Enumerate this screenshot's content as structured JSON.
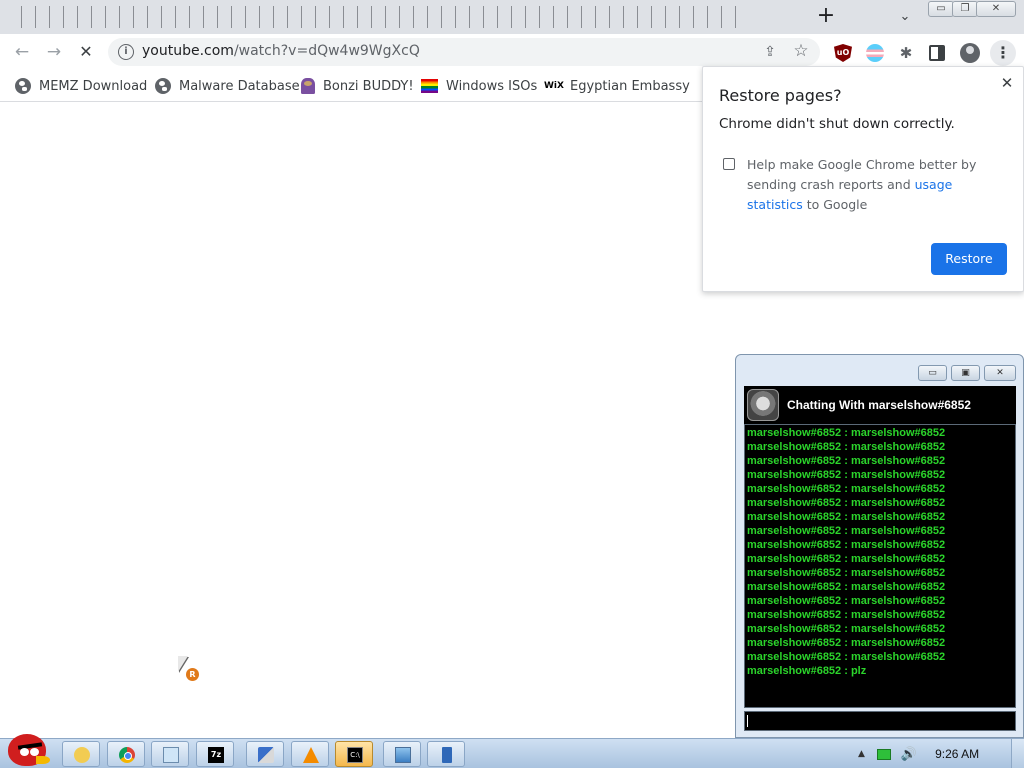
{
  "browser": {
    "tab_count": 52,
    "new_tab_glyph": "+",
    "tab_search_glyph": "⌄",
    "window_controls": {
      "minimize": "▭",
      "maximize": "❐",
      "close": "✕"
    },
    "nav": {
      "back": "←",
      "forward": "→",
      "stop": "✕"
    },
    "url_host": "youtube.com",
    "url_path": "/watch?v=dQw4w9WgXcQ",
    "icons": [
      "lock-icon",
      "share-icon",
      "star-icon",
      "ublock-icon",
      "trans-flag-extension-icon",
      "puzzle-icon",
      "side-panel-icon",
      "profile-icon",
      "menu-icon"
    ],
    "extensions": {
      "ublock_label": "uO",
      "menu_glyph": "⋮",
      "puzzle_glyph": "✱"
    }
  },
  "bookmarks": [
    {
      "label": "MEMZ Download",
      "icon": "globe-icon"
    },
    {
      "label": "Malware Database",
      "icon": "globe-icon"
    },
    {
      "label": "Bonzi BUDDY!",
      "icon": "bonzi-icon"
    },
    {
      "label": "Windows ISOs",
      "icon": "rainbow-flag-icon"
    },
    {
      "label": "Egyptian Embassy",
      "icon": "wix-icon",
      "icon_text": "WiX"
    }
  ],
  "restore_dialog": {
    "title": "Restore pages?",
    "message": "Chrome didn't shut down correctly.",
    "checkbox_text_before": "Help make Google Chrome better by sending crash reports and ",
    "checkbox_link": "usage statistics",
    "checkbox_text_after": " to Google",
    "checkbox_checked": false,
    "close_glyph": "✕",
    "button": "Restore",
    "button_color": "#1a73e8"
  },
  "chat": {
    "title": "Chatting With marselshow#6852",
    "controls": {
      "minimize": "▭",
      "maximize": "▣",
      "close": "✕"
    },
    "text_color": "#2bd42b",
    "messages": [
      "marselshow#6852 : marselshow#6852",
      "marselshow#6852 : marselshow#6852",
      "marselshow#6852 : marselshow#6852",
      "marselshow#6852 : marselshow#6852",
      "marselshow#6852 : marselshow#6852",
      "marselshow#6852 : marselshow#6852",
      "marselshow#6852 : marselshow#6852",
      "marselshow#6852 : marselshow#6852",
      "marselshow#6852 : marselshow#6852",
      "marselshow#6852 : marselshow#6852",
      "marselshow#6852 : marselshow#6852",
      "marselshow#6852 : marselshow#6852",
      "marselshow#6852 : marselshow#6852",
      "marselshow#6852 : marselshow#6852",
      "marselshow#6852 : marselshow#6852",
      "marselshow#6852 : marselshow#6852",
      "marselshow#6852 : marselshow#6852",
      "marselshow#6852 : plz"
    ],
    "input_value": ""
  },
  "cursor": {
    "icon": "cursor-arrow-icon",
    "badge": "R"
  },
  "taskbar": {
    "start_icon": "angry-bird-icon",
    "apps": [
      {
        "name": "explorer",
        "icon": "folder-icon",
        "active": false
      },
      {
        "name": "chrome",
        "icon": "chrome-icon",
        "active": false
      },
      {
        "name": "notepad",
        "icon": "notepad-icon",
        "active": false
      },
      {
        "name": "7zip",
        "icon": "7zip-icon",
        "active": false,
        "text": "7z"
      },
      {
        "name": "control",
        "icon": "control-panel-icon",
        "active": false
      },
      {
        "name": "vlc",
        "icon": "vlc-icon",
        "active": false
      },
      {
        "name": "cmd",
        "icon": "cmd-icon",
        "active": true,
        "text": "C:\\"
      },
      {
        "name": "photos",
        "icon": "photo-viewer-icon",
        "active": false
      },
      {
        "name": "doc",
        "icon": "document-icon",
        "active": false
      }
    ],
    "tray": {
      "arrow": "▲",
      "volume": "🔊",
      "clock": "9:26 AM"
    }
  }
}
